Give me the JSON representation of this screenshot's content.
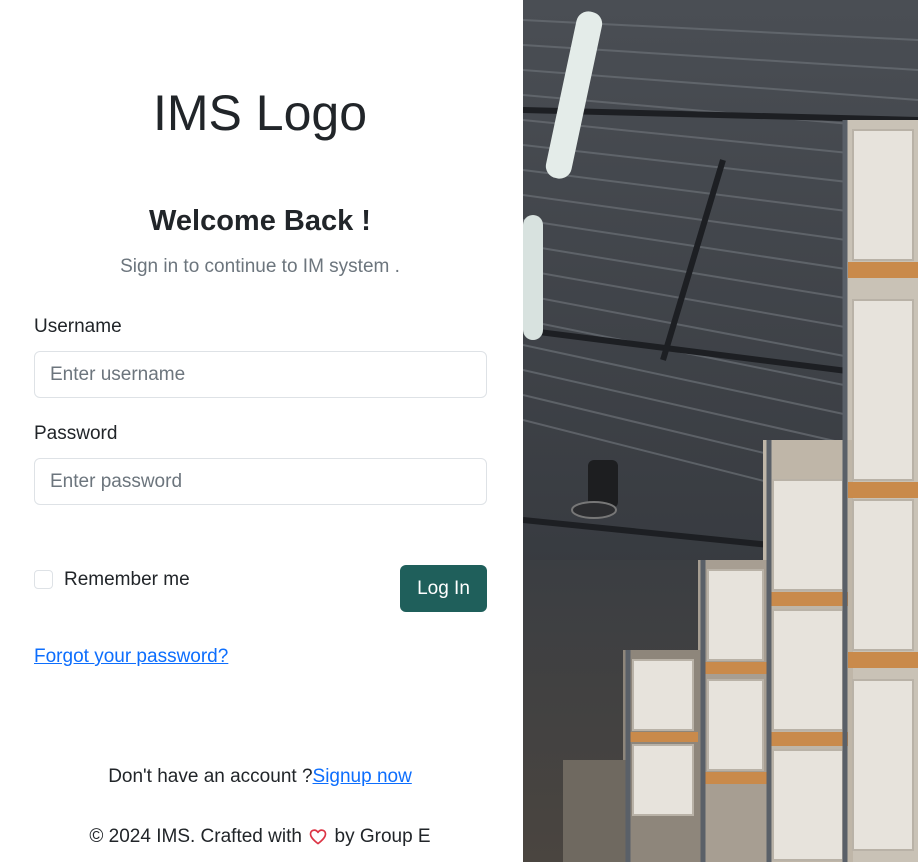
{
  "brand": {
    "logo_text": "IMS Logo"
  },
  "login": {
    "heading": "Welcome Back !",
    "subtitle": "Sign in to continue to IM system .",
    "username_label": "Username",
    "username_placeholder": "Enter username",
    "username_value": "",
    "password_label": "Password",
    "password_placeholder": "Enter password",
    "password_value": "",
    "remember_label": "Remember me",
    "remember_checked": false,
    "login_button": "Log In",
    "forgot_link": "Forgot your password?"
  },
  "signup": {
    "prompt": "Don't have an account ?",
    "link": "Signup now"
  },
  "footer": {
    "prefix": "© 2024 IMS. Crafted with",
    "suffix": "by Group E",
    "heart_icon": "heart-icon"
  },
  "hero_image": {
    "subject": "warehouse-shelves-photo"
  },
  "colors": {
    "primary_button": "#1f5f5b",
    "link": "#0d6efd",
    "heart": "#dc3545",
    "muted_text": "#6c757d"
  }
}
